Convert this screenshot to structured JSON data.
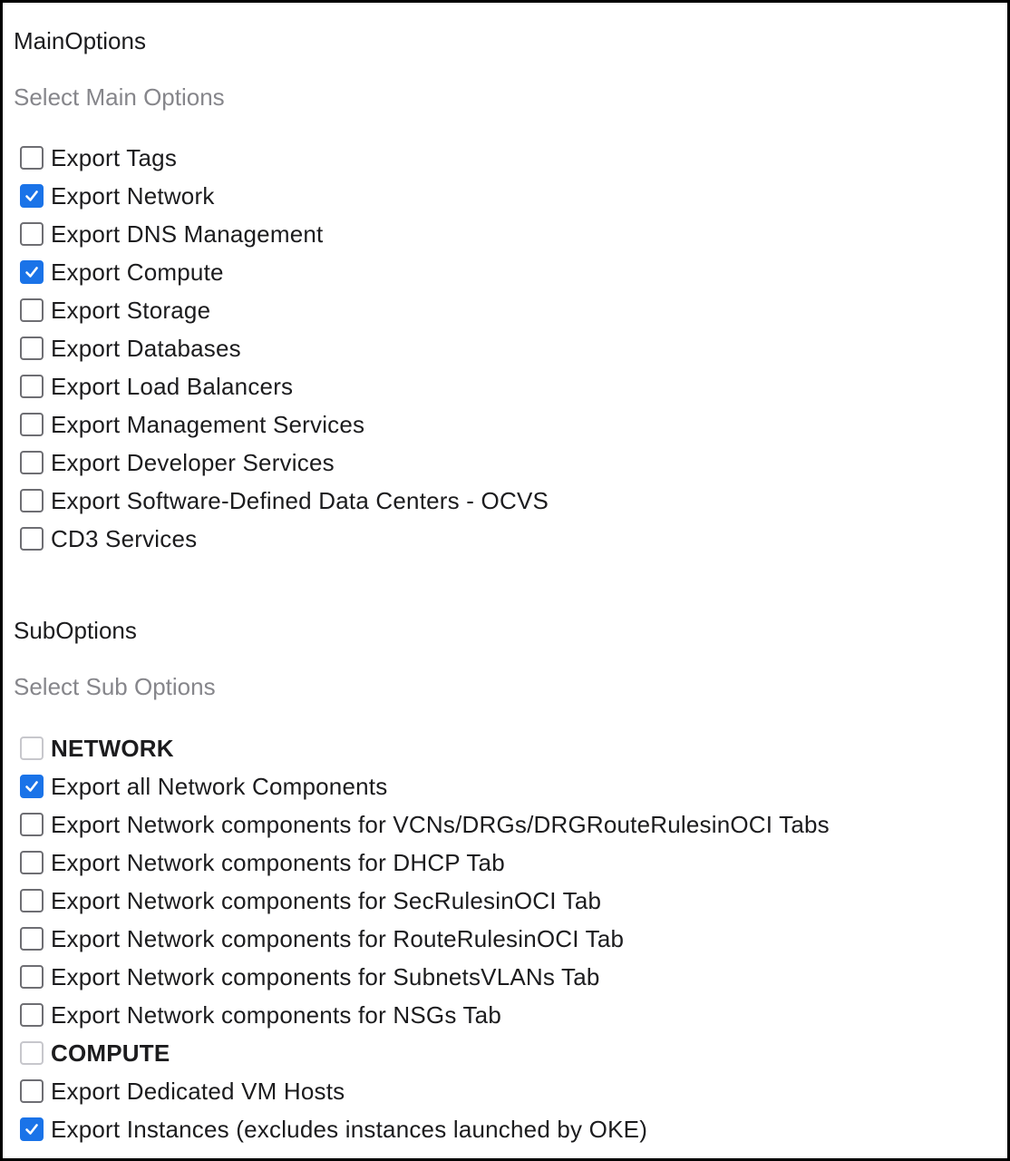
{
  "main_options": {
    "title": "MainOptions",
    "hint": "Select Main Options",
    "items": [
      {
        "label": "Export Tags",
        "checked": false
      },
      {
        "label": "Export Network",
        "checked": true
      },
      {
        "label": "Export DNS Management",
        "checked": false
      },
      {
        "label": "Export Compute",
        "checked": true
      },
      {
        "label": "Export Storage",
        "checked": false
      },
      {
        "label": "Export Databases",
        "checked": false
      },
      {
        "label": "Export Load Balancers",
        "checked": false
      },
      {
        "label": "Export Management Services",
        "checked": false
      },
      {
        "label": "Export Developer Services",
        "checked": false
      },
      {
        "label": "Export Software-Defined Data Centers - OCVS",
        "checked": false
      },
      {
        "label": "CD3 Services",
        "checked": false
      }
    ]
  },
  "sub_options": {
    "title": "SubOptions",
    "hint": "Select Sub Options",
    "items": [
      {
        "label": "NETWORK",
        "checked": false,
        "group": true
      },
      {
        "label": "Export all Network Components",
        "checked": true,
        "group": false
      },
      {
        "label": "Export Network components for VCNs/DRGs/DRGRouteRulesinOCI Tabs",
        "checked": false,
        "group": false
      },
      {
        "label": "Export Network components for DHCP Tab",
        "checked": false,
        "group": false
      },
      {
        "label": "Export Network components for SecRulesinOCI Tab",
        "checked": false,
        "group": false
      },
      {
        "label": "Export Network components for RouteRulesinOCI Tab",
        "checked": false,
        "group": false
      },
      {
        "label": "Export Network components for SubnetsVLANs Tab",
        "checked": false,
        "group": false
      },
      {
        "label": "Export Network components for NSGs Tab",
        "checked": false,
        "group": false
      },
      {
        "label": "COMPUTE",
        "checked": false,
        "group": true
      },
      {
        "label": "Export Dedicated VM Hosts",
        "checked": false,
        "group": false
      },
      {
        "label": "Export Instances (excludes instances launched by OKE)",
        "checked": true,
        "group": false
      }
    ]
  },
  "colors": {
    "accent": "#1a73e8",
    "hint_text": "#86868b"
  }
}
